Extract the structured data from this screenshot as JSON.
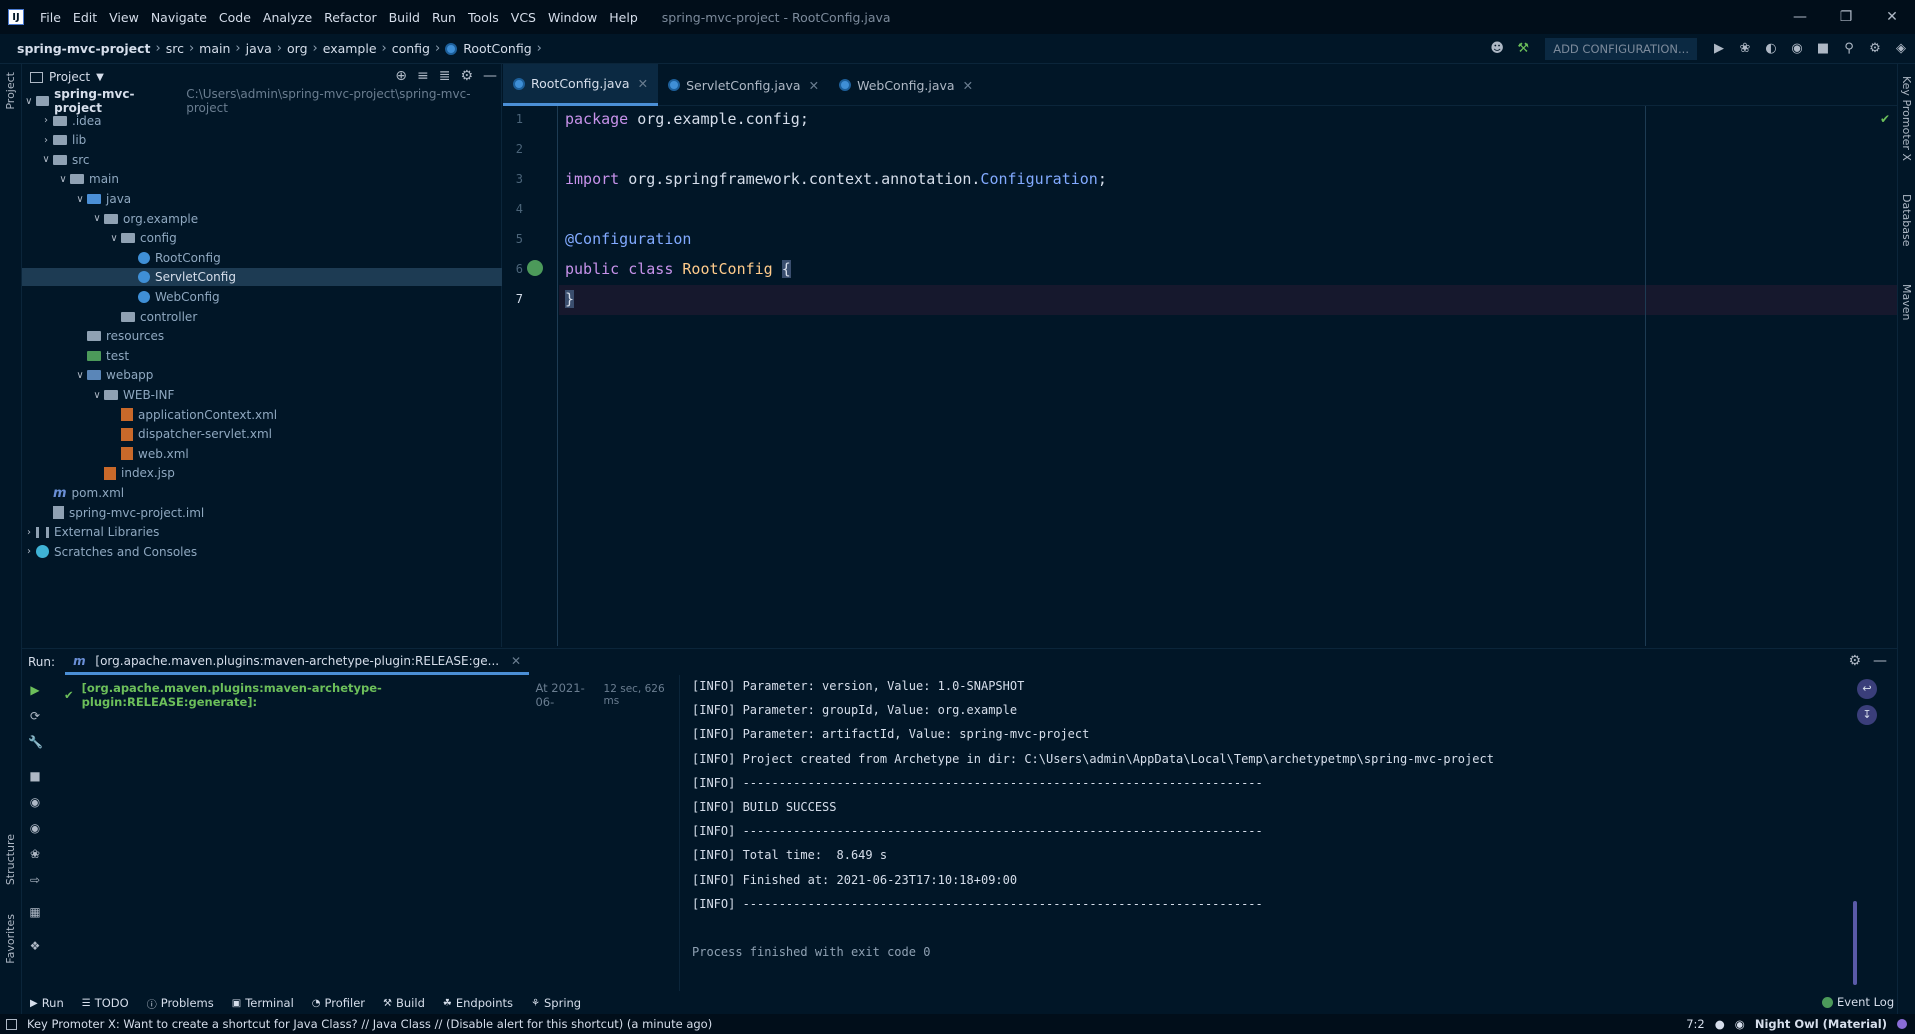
{
  "titlebar": {
    "menu": [
      "File",
      "Edit",
      "View",
      "Navigate",
      "Code",
      "Analyze",
      "Refactor",
      "Build",
      "Run",
      "Tools",
      "VCS",
      "Window",
      "Help"
    ],
    "window_title": "spring-mvc-project - RootConfig.java"
  },
  "breadcrumb": [
    "spring-mvc-project",
    "src",
    "main",
    "java",
    "org",
    "example",
    "config",
    "RootConfig"
  ],
  "toolbar": {
    "add_configuration": "ADD CONFIGURATION..."
  },
  "left_strip": {
    "project": "Project",
    "structure": "Structure",
    "favorites": "Favorites"
  },
  "right_strip": {
    "key_promoter": "Key Promoter X",
    "database": "Database",
    "maven": "Maven"
  },
  "project_panel": {
    "title": "Project",
    "root_path": "C:\\Users\\admin\\spring-mvc-project\\spring-mvc-project",
    "tree": [
      {
        "label": "spring-mvc-project",
        "depth": 0,
        "arrow": "v",
        "icon": "folder"
      },
      {
        "label": ".idea",
        "depth": 1,
        "arrow": ">",
        "icon": "folder"
      },
      {
        "label": "lib",
        "depth": 1,
        "arrow": ">",
        "icon": "folder"
      },
      {
        "label": "src",
        "depth": 1,
        "arrow": "v",
        "icon": "folder"
      },
      {
        "label": "main",
        "depth": 2,
        "arrow": "v",
        "icon": "folder"
      },
      {
        "label": "java",
        "depth": 3,
        "arrow": "v",
        "icon": "folder-blue"
      },
      {
        "label": "org.example",
        "depth": 4,
        "arrow": "v",
        "icon": "folder"
      },
      {
        "label": "config",
        "depth": 5,
        "arrow": "v",
        "icon": "folder"
      },
      {
        "label": "RootConfig",
        "depth": 6,
        "arrow": "",
        "icon": "class"
      },
      {
        "label": "ServletConfig",
        "depth": 6,
        "arrow": "",
        "icon": "class",
        "selected": true
      },
      {
        "label": "WebConfig",
        "depth": 6,
        "arrow": "",
        "icon": "class"
      },
      {
        "label": "controller",
        "depth": 5,
        "arrow": "",
        "icon": "folder"
      },
      {
        "label": "resources",
        "depth": 3,
        "arrow": "",
        "icon": "folder"
      },
      {
        "label": "test",
        "depth": 3,
        "arrow": "",
        "icon": "folder-green"
      },
      {
        "label": "webapp",
        "depth": 3,
        "arrow": "v",
        "icon": "folder-web"
      },
      {
        "label": "WEB-INF",
        "depth": 4,
        "arrow": "v",
        "icon": "folder"
      },
      {
        "label": "applicationContext.xml",
        "depth": 5,
        "arrow": "",
        "icon": "xml"
      },
      {
        "label": "dispatcher-servlet.xml",
        "depth": 5,
        "arrow": "",
        "icon": "xml"
      },
      {
        "label": "web.xml",
        "depth": 5,
        "arrow": "",
        "icon": "xml"
      },
      {
        "label": "index.jsp",
        "depth": 4,
        "arrow": "",
        "icon": "xml"
      },
      {
        "label": "pom.xml",
        "depth": 1,
        "arrow": "",
        "icon": "maven"
      },
      {
        "label": "spring-mvc-project.iml",
        "depth": 1,
        "arrow": "",
        "icon": "iml"
      },
      {
        "label": "External Libraries",
        "depth": 0,
        "arrow": ">",
        "icon": "lib"
      },
      {
        "label": "Scratches and Consoles",
        "depth": 0,
        "arrow": ">",
        "icon": "scratch"
      }
    ]
  },
  "editor": {
    "tabs": [
      {
        "label": "RootConfig.java",
        "active": true
      },
      {
        "label": "ServletConfig.java",
        "active": false
      },
      {
        "label": "WebConfig.java",
        "active": false
      }
    ],
    "lines": [
      {
        "n": "1",
        "tokens": [
          [
            "kw",
            "package "
          ],
          [
            "pkg",
            "org.example.config"
          ],
          [
            "pkg",
            ";"
          ]
        ]
      },
      {
        "n": "2",
        "tokens": []
      },
      {
        "n": "3",
        "tokens": [
          [
            "kw",
            "import "
          ],
          [
            "pkg",
            "org.springframework.context.annotation."
          ],
          [
            "ann",
            "Configuration"
          ],
          [
            "pkg",
            ";"
          ]
        ]
      },
      {
        "n": "4",
        "tokens": []
      },
      {
        "n": "5",
        "tokens": [
          [
            "ann",
            "@Configuration"
          ]
        ]
      },
      {
        "n": "6",
        "tokens": [
          [
            "kw",
            "public class "
          ],
          [
            "cls",
            "RootConfig "
          ],
          [
            "brace",
            "{"
          ]
        ]
      },
      {
        "n": "7",
        "tokens": [
          [
            "brace",
            "}"
          ]
        ]
      }
    ]
  },
  "run": {
    "label": "Run:",
    "tab": "[org.apache.maven.plugins:maven-archetype-plugin:RELEASE:ge...",
    "tree_item": "[org.apache.maven.plugins:maven-archetype-plugin:RELEASE:generate]:",
    "tree_time": "At 2021-06-",
    "tree_duration": "12 sec, 626 ms",
    "console": [
      "[INFO] Parameter: version, Value: 1.0-SNAPSHOT",
      "[INFO] Parameter: groupId, Value: org.example",
      "[INFO] Parameter: artifactId, Value: spring-mvc-project",
      "[INFO] Project created from Archetype in dir: C:\\Users\\admin\\AppData\\Local\\Temp\\archetypetmp\\spring-mvc-project",
      "[INFO] ------------------------------------------------------------------------",
      "[INFO] BUILD SUCCESS",
      "[INFO] ------------------------------------------------------------------------",
      "[INFO] Total time:  8.649 s",
      "[INFO] Finished at: 2021-06-23T17:10:18+09:00",
      "[INFO] ------------------------------------------------------------------------",
      "",
      "Process finished with exit code 0"
    ]
  },
  "bottom_tabs": [
    "Run",
    "TODO",
    "Problems",
    "Terminal",
    "Profiler",
    "Build",
    "Endpoints",
    "Spring"
  ],
  "event_log": "Event Log",
  "status": {
    "message": "Key Promoter X: Want to create a shortcut for Java Class? // Java Class // (Disable alert for this shortcut) (a minute ago)",
    "position": "7:2",
    "theme": "Night Owl (Material)"
  }
}
